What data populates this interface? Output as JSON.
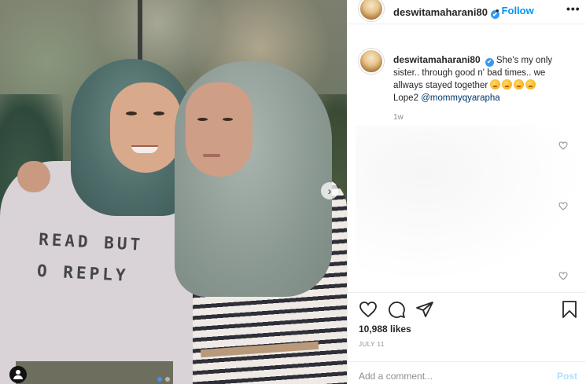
{
  "post": {
    "username": "deswitamaharani80",
    "verified": "✔",
    "separator": "•",
    "follow_label": "Follow",
    "more_label": "•••",
    "photo": {
      "sweater_line1": "READ BUT",
      "sweater_line2": "O REPLY",
      "carousel_next_label": "›"
    },
    "caption": {
      "username": "deswitamaharani80",
      "text": "She's my only sister.. through good n' bad times.. we allways stayed together",
      "tail": "Lope2",
      "mention": "@mommyqyarapha",
      "time_ago": "1w"
    },
    "likes_label": "10,988 likes",
    "date_label": "JULY 11",
    "comment_input": {
      "placeholder": "Add a comment...",
      "post_label": "Post"
    }
  },
  "colors": {
    "accent": "#0095f6",
    "verified": "#3897f0",
    "post_disabled": "#b2dffc",
    "muted_text": "#8e8e8e",
    "mention": "#00376b"
  },
  "icons": [
    "more-options-icon",
    "verified-icon",
    "heart-icon",
    "comment-icon",
    "share-icon",
    "bookmark-icon",
    "chevron-right-icon",
    "user-tag-icon",
    "emoji-icon"
  ]
}
